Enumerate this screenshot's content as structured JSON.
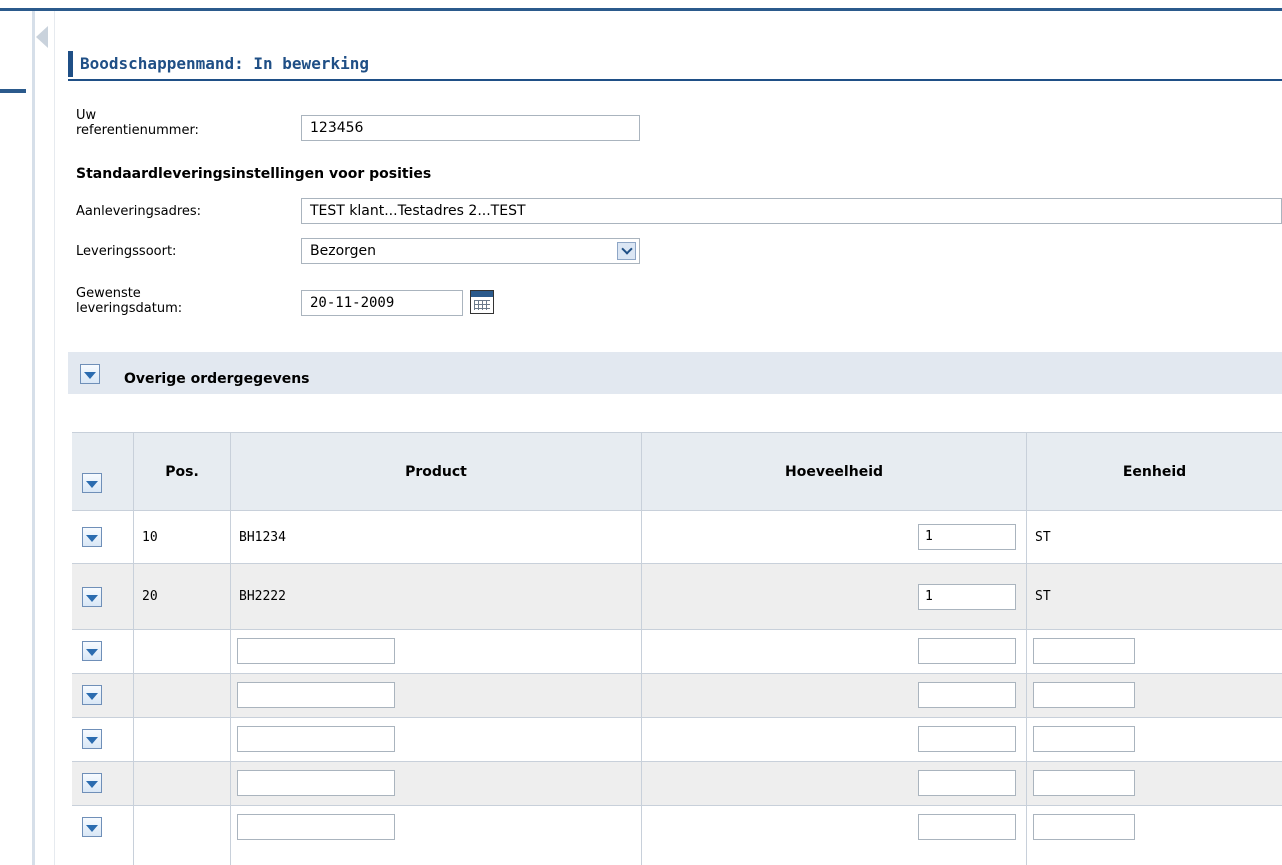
{
  "header": {
    "title": "Boodschappenmand: In bewerking"
  },
  "form": {
    "reference": {
      "label_line1": "Uw",
      "label_line2": "referentienummer:",
      "value": "123456"
    },
    "defaults_heading": "Standaardleveringsinstellingen voor posities",
    "address": {
      "label": "Aanleveringsadres:",
      "value": "TEST klant...Testadres 2...TEST"
    },
    "delivery_type": {
      "label": "Leveringssoort:",
      "value": "Bezorgen"
    },
    "delivery_date": {
      "label_line1": "Gewenste",
      "label_line2": "leveringsdatum:",
      "value": "20-11-2009"
    }
  },
  "group": {
    "label": "Overige ordergegevens"
  },
  "table": {
    "columns": [
      "Pos.",
      "Product",
      "Hoeveelheid",
      "Eenheid"
    ],
    "rows": [
      {
        "pos": "10",
        "product": "BH1234",
        "quantity": "1",
        "unit": "ST"
      },
      {
        "pos": "20",
        "product": "BH2222",
        "quantity": "1",
        "unit": "ST"
      },
      {
        "pos": "",
        "product": "",
        "quantity": "",
        "unit": ""
      },
      {
        "pos": "",
        "product": "",
        "quantity": "",
        "unit": ""
      },
      {
        "pos": "",
        "product": "",
        "quantity": "",
        "unit": ""
      },
      {
        "pos": "",
        "product": "",
        "quantity": "",
        "unit": ""
      },
      {
        "pos": "",
        "product": "",
        "quantity": "",
        "unit": ""
      }
    ]
  }
}
